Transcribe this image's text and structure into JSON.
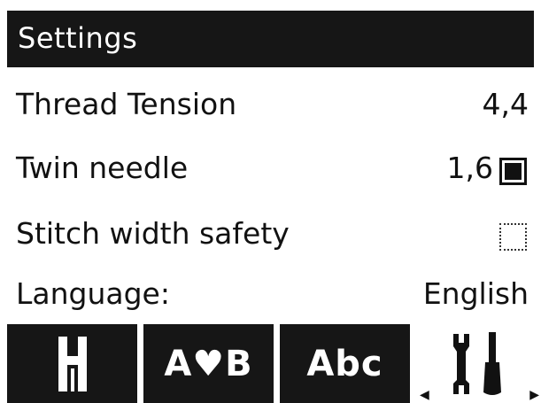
{
  "header": {
    "title": "Settings"
  },
  "settings": [
    {
      "label": "Thread Tension",
      "value": "4,4"
    },
    {
      "label": "Twin needle",
      "value": "1,6",
      "checked": true
    },
    {
      "label": "Stitch width safety",
      "checked": false
    },
    {
      "label": "Language:",
      "value": "English"
    }
  ],
  "tabs": [
    {
      "icon": "presser-foot-icon"
    },
    {
      "label": "A♥B"
    },
    {
      "label": "Abc"
    },
    {
      "icon": "tools-icon",
      "active": true
    }
  ],
  "colors": {
    "bar": "#161616",
    "background": "#ffffff",
    "text": "#111111"
  }
}
